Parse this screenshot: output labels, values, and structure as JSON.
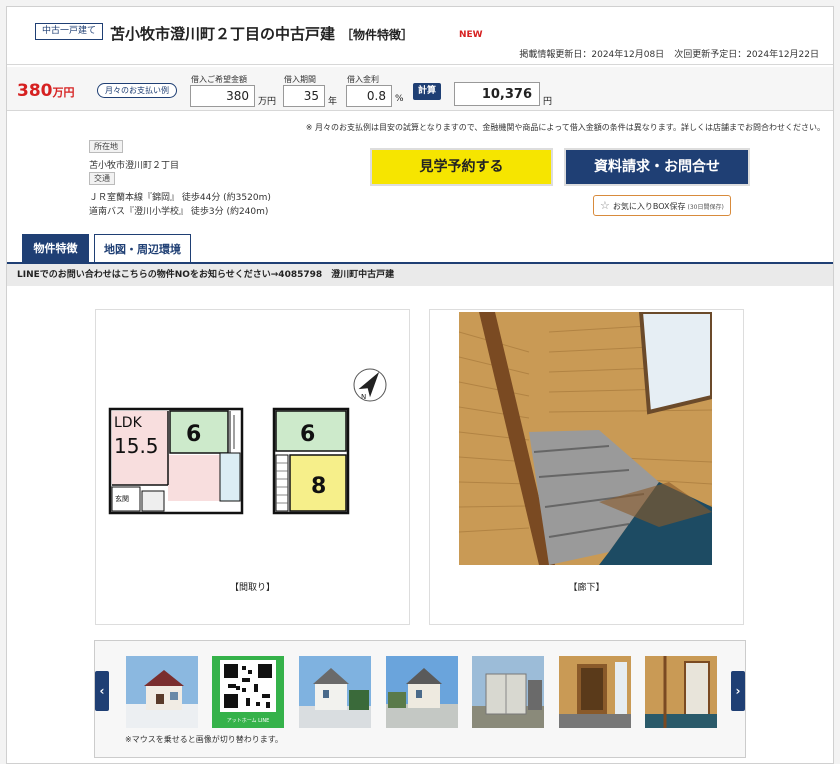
{
  "header": {
    "type_badge": "中古一戸建て",
    "title": "苫小牧市澄川町２丁目の中古戸建",
    "subtitle": "［物件特徴］",
    "new_label": "NEW",
    "published": "掲載情報更新日：2024年12月08日",
    "next_update": "次回更新予定日：2024年12月22日"
  },
  "loan": {
    "price_value": "380",
    "price_unit": "万円",
    "monthly_badge": "月々のお支払い例",
    "amount_label": "借入ご希望金額",
    "amount_value": "380",
    "amount_unit": "万円",
    "term_label": "借入期間",
    "term_value": "35",
    "term_unit": "年",
    "rate_label": "借入金利",
    "rate_value": "0.8",
    "rate_unit": "%",
    "calc_label": "計算",
    "result_value": "10,376",
    "result_unit": "円",
    "note": "※ 月々のお支払例は目安の試算となりますので、金融機関や商品によって借入金額の条件は異なります。詳しくは店舗までお問合わせください。"
  },
  "info": {
    "location_label": "所在地",
    "location_value": "苫小牧市澄川町２丁目",
    "transport_label": "交通",
    "transport_1": "ＪＲ室蘭本線『錦岡』 徒歩44分 (約3520m)",
    "transport_2": "道南バス『澄川小学校』 徒歩3分 (約240m)"
  },
  "actions": {
    "visit_label": "見学予約する",
    "request_label": "資料請求・お問合せ",
    "favorite_label": "お気に入りBOX保存",
    "favorite_note": "(30日間保存)"
  },
  "tabs": [
    {
      "label": "物件特徴"
    },
    {
      "label": "地図・周辺環境"
    }
  ],
  "line_notice": "LINEでのお問い合わせはこちらの物件NOをお知らせください→4085798　澄川町中古戸建",
  "photos": [
    {
      "caption": "【間取り】"
    },
    {
      "caption": "【廊下】"
    }
  ],
  "floorplan": {
    "ldk_label": "LDK",
    "ldk_size": "15.5",
    "room_1": "6",
    "room_2": "6",
    "room_3": "8",
    "entrance": "玄関",
    "compass": "N"
  },
  "thumbnails": {
    "hover_note": "※マウスを乗せると画像が切り替わります。",
    "qr_caption": "アットホーム LINE",
    "prev_icon": "chevron-left-icon",
    "next_icon": "chevron-right-icon"
  },
  "colors": {
    "brand_navy": "#1f3f74",
    "price_red": "#d62121",
    "visit_yellow": "#f6e500"
  }
}
